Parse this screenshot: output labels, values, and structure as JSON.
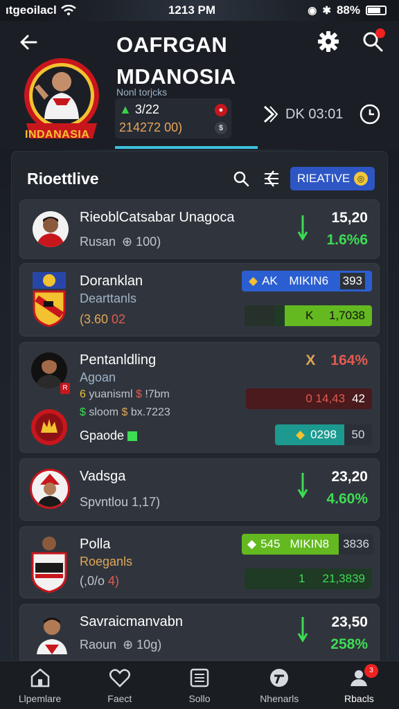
{
  "status_bar": {
    "carrier": "ıtgeoilacl",
    "time": "1213 PM",
    "battery": "88%"
  },
  "header": {
    "title_line1": "OAFRGAN",
    "title_line2": "MDANOSIA",
    "subtitle": "Nonl torjcks",
    "stat1": "3/22",
    "stat2": "214272 00)",
    "time_text": "DK  03:01",
    "logo_text": "INDANASIA"
  },
  "panel": {
    "title": "Rioettlive",
    "realtime_label": "RIEATIVE"
  },
  "cards": [
    {
      "name": "RieoblCatsabar Unagoca",
      "sub": "Rusan",
      "sub_extra": "100)",
      "value": "15,20",
      "pct": "1.6%6"
    },
    {
      "name": "Doranklan",
      "sub": "Dearttanls",
      "sub2": "(3.60",
      "sub2_red": "02",
      "pill1_left": "AK",
      "pill1_right": "MIKIN6",
      "pill1_val": "393",
      "pill2_icon": "K",
      "pill2_val": "1,7038"
    },
    {
      "name": "Pentanldling",
      "sub": "Agoan",
      "row1_a": "yuanisml",
      "row1_b": "!7bm",
      "row2_a": "sloom",
      "row2_b": "bx.7223",
      "extra_label": "Gpaode",
      "pct_label": "X",
      "pct": "164%",
      "pill_red_text": "0 14,43",
      "pill_red_val": "42",
      "pill_teal_text": "0298",
      "pill_teal_val": "50"
    },
    {
      "name": "Vadsga",
      "sub": "Spvntlou 1,17)",
      "value": "23,20",
      "pct": "4.60%"
    },
    {
      "name": "Polla",
      "sub": "Roeganls",
      "sub2": "(,0/o",
      "sub2_red": "4)",
      "pill1_left": "545",
      "pill1_right": "MIKIN8",
      "pill1_val": "3836",
      "pill2_icon": "1",
      "pill2_val": "21,3839"
    },
    {
      "name": "Savraicmanvabn",
      "sub": "Raoun",
      "sub_extra": "10g)",
      "value": "23,50",
      "pct": "258%"
    }
  ],
  "nav": [
    {
      "label": "Llpemlare",
      "icon": "home-icon"
    },
    {
      "label": "Faect",
      "icon": "heart-icon"
    },
    {
      "label": "Sollo",
      "icon": "list-icon"
    },
    {
      "label": "Nhenarls",
      "icon": "whistle-icon"
    },
    {
      "label": "Rbacls",
      "icon": "profile-icon",
      "badge": "3"
    }
  ],
  "colors": {
    "accent": "#3ec0e0",
    "green": "#3edc54",
    "orange": "#e0a656",
    "red": "#e25a4f",
    "blue": "#2b5fd1"
  }
}
